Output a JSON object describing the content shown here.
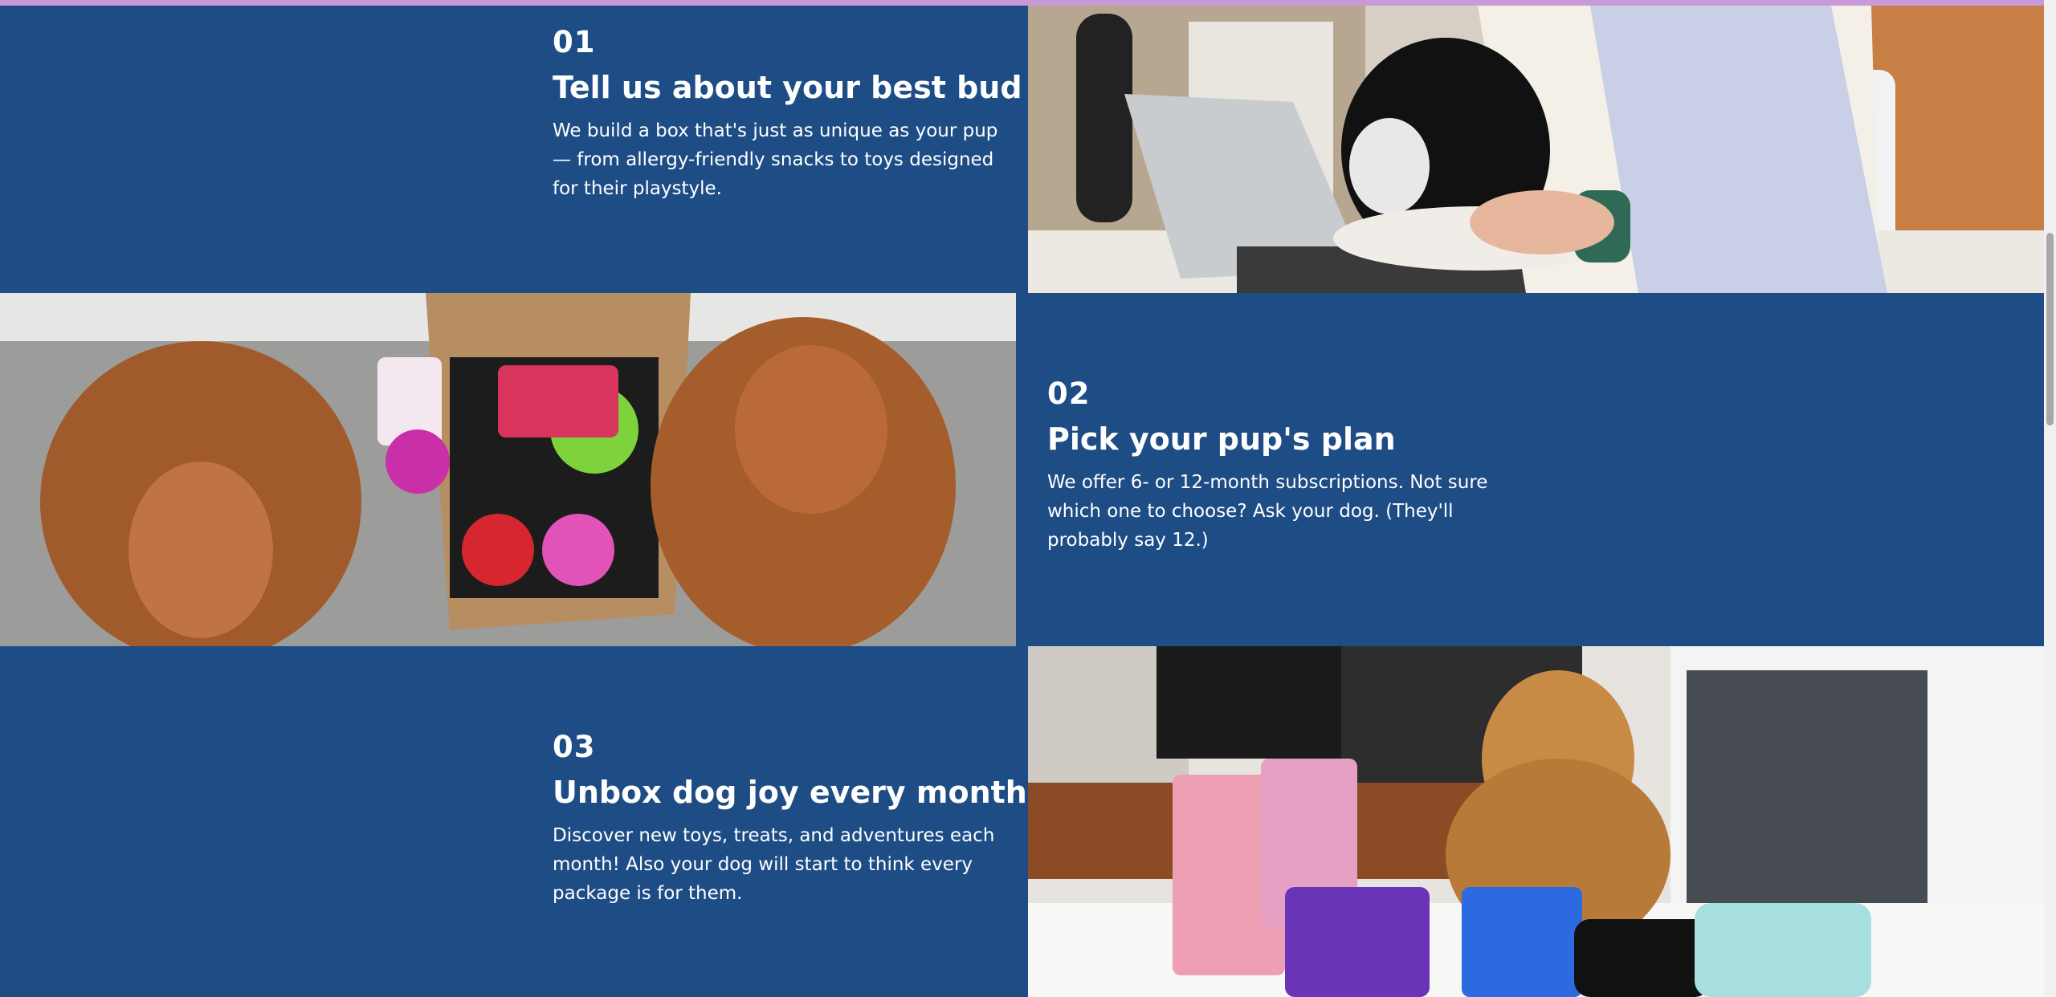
{
  "steps": [
    {
      "number": "01",
      "title": "Tell us about your best bud",
      "description": "We build a box that's just as unique as your pup — from allergy-friendly snacks to toys designed for their playstyle."
    },
    {
      "number": "02",
      "title": "Pick your pup's plan",
      "description": "We offer 6- or 12-month subscriptions. Not sure which one to choose? Ask your dog. (They'll probably say 12.)"
    },
    {
      "number": "03",
      "title": "Unbox dog joy every month",
      "description": "Discover new toys, treats, and adventures each month! Also your dog will start to think every package is for them."
    }
  ],
  "photos": {
    "step1": "person-holding-puppy-at-laptop-photo",
    "step2": "two-dogs-with-toy-box-photo",
    "step3": "golden-retriever-with-treats-photo"
  },
  "colors": {
    "background": "#1e4d86",
    "accent_bar": "#c99ad8",
    "text": "#ffffff"
  }
}
